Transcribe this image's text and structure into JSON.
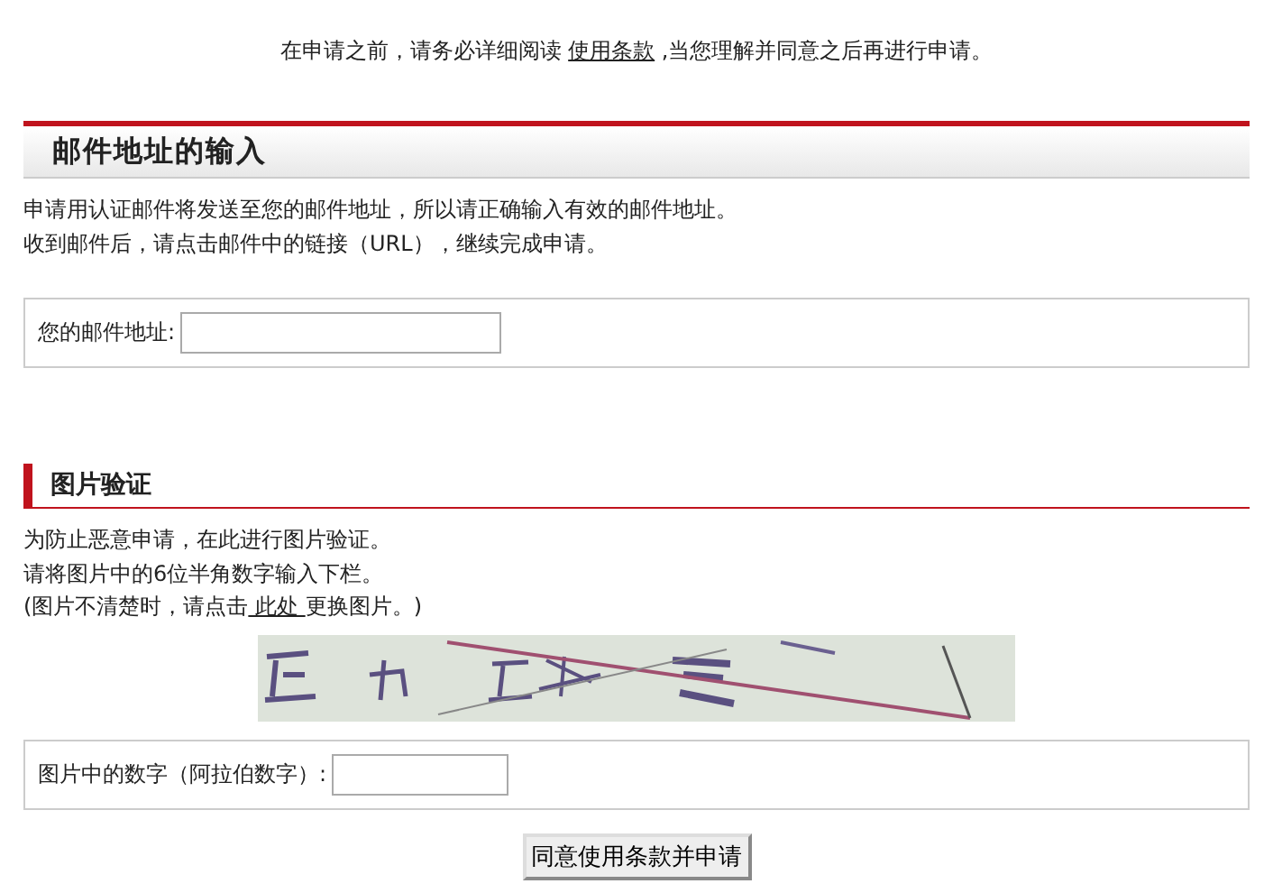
{
  "notice": {
    "before": "在申请之前，请务必详细阅读 ",
    "link": "使用条款",
    "after": " ,当您理解并同意之后再进行申请。"
  },
  "email_section": {
    "title": "邮件地址的输入",
    "lines": [
      "申请用认证邮件将发送至您的邮件地址，所以请正确输入有效的邮件地址。",
      "收到邮件后，请点击邮件中的链接（URL），继续完成申请。"
    ],
    "field_label": "您的邮件地址:"
  },
  "captcha_section": {
    "title": "图片验证",
    "lines": [
      "为防止恶意申请，在此进行图片验证。",
      "请将图片中的6位半角数字输入下栏。"
    ],
    "refresh": {
      "before": "(图片不清楚时，请点击",
      "link": " 此处 ",
      "after": "更换图片。)"
    },
    "field_label": "图片中的数字（阿拉伯数字）:"
  },
  "submit_button": "同意使用条款并申请"
}
